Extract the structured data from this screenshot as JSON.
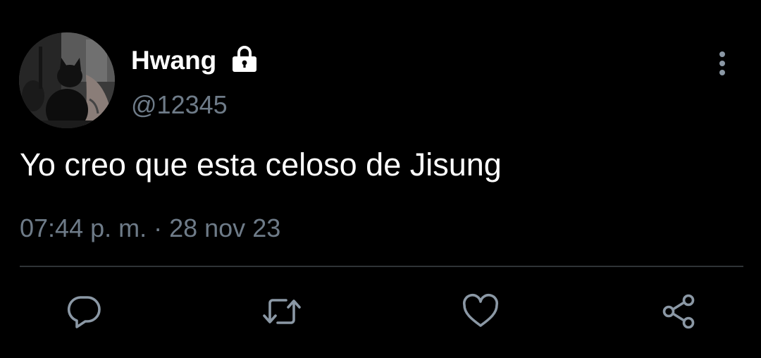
{
  "user": {
    "display_name": "Hwang",
    "handle": "@12345",
    "protected_icon": "lock-icon",
    "avatar": "profile-photo-cat"
  },
  "tweet": {
    "text": "Yo creo que esta celoso de Jisung",
    "timestamp": "07:44 p. m. · 28 nov 23"
  },
  "actions": [
    {
      "name": "reply",
      "icon": "reply-icon"
    },
    {
      "name": "retweet",
      "icon": "retweet-icon"
    },
    {
      "name": "like",
      "icon": "heart-icon"
    },
    {
      "name": "share",
      "icon": "share-icon"
    }
  ],
  "menu": {
    "icon": "more-vertical-icon"
  },
  "colors": {
    "background": "#000000",
    "primary_text": "#ffffff",
    "secondary_text": "#6e7b88",
    "divider": "#2f3336",
    "icon": "#8b98a5"
  }
}
